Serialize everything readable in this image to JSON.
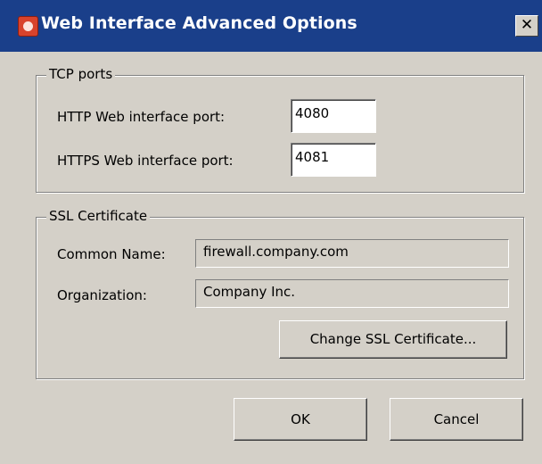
{
  "window": {
    "title": "Web Interface Advanced Options",
    "close_glyph": "✕",
    "icon": "app-icon"
  },
  "tcp_ports": {
    "group_title": "TCP ports",
    "http_label": "HTTP Web interface port:",
    "http_value": "4080",
    "https_label": "HTTPS Web interface port:",
    "https_value": "4081"
  },
  "ssl": {
    "group_title": "SSL Certificate",
    "common_name_label": "Common Name:",
    "common_name_value": "firewall.company.com",
    "organization_label": "Organization:",
    "organization_value": "Company Inc.",
    "change_button": "Change SSL Certificate..."
  },
  "buttons": {
    "ok": "OK",
    "cancel": "Cancel"
  },
  "colors": {
    "titlebar": "#1a3f8a",
    "face": "#d4d0c8"
  }
}
